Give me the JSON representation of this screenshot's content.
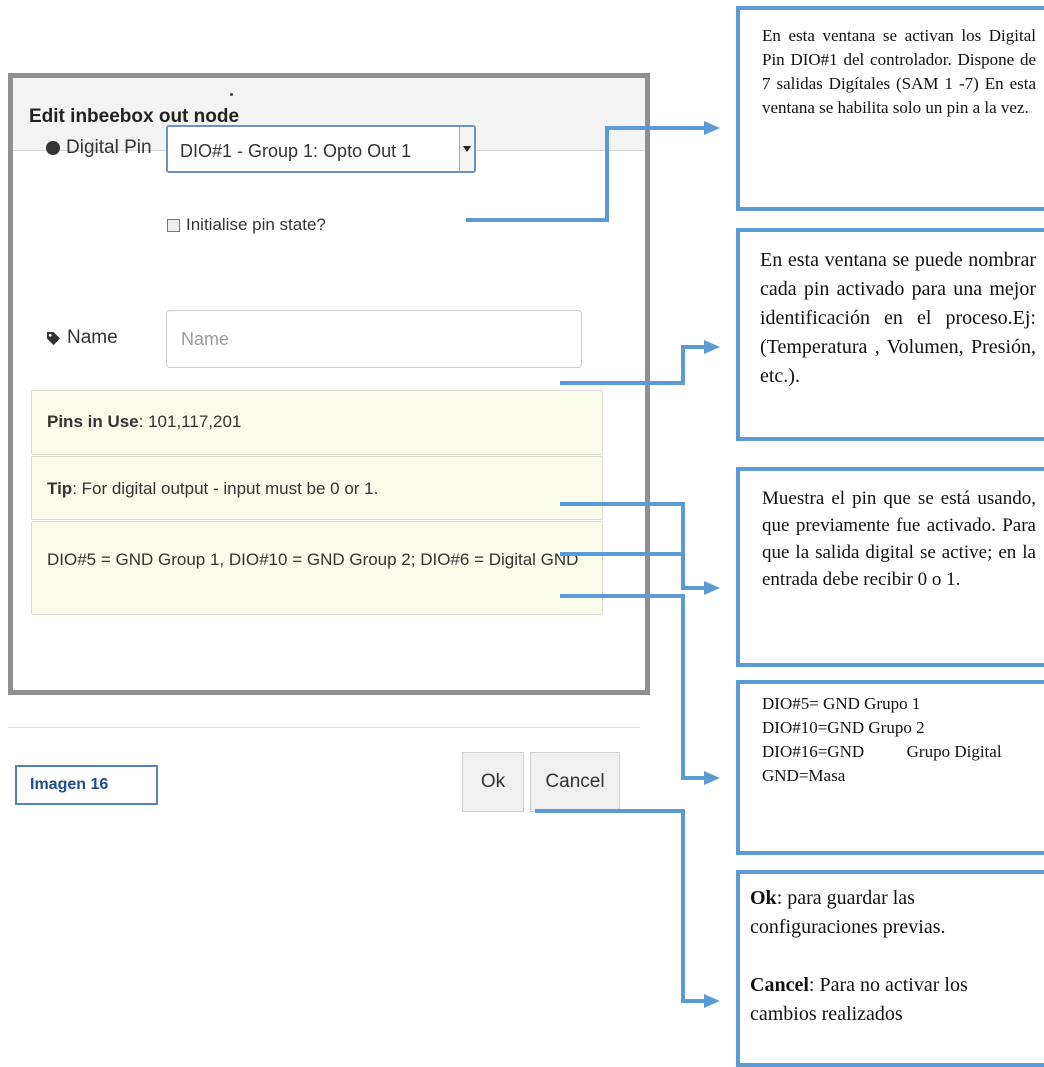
{
  "dialog": {
    "title": "Edit inbeebox out node",
    "dot_mark": ".",
    "digital_pin": {
      "label": "Digital Pin",
      "icon": "circle-icon",
      "selected": "DIO#1 - Group 1: Opto Out 1"
    },
    "initialise": {
      "label": "Initialise pin state?"
    },
    "name_field": {
      "label": "Name",
      "icon": "tag-icon",
      "placeholder": "Name",
      "value": ""
    },
    "tips": {
      "pins_in_use_label": "Pins in Use",
      "pins_in_use_value": ": 101,117,201",
      "tip_label": "Tip",
      "tip_value": ": For digital output - input must be 0 or 1.",
      "gnd_text": "DIO#5 = GND Group 1, DIO#10 = GND Group 2; DIO#6 = Digital GND"
    },
    "buttons": {
      "ok": "Ok",
      "cancel": "Cancel"
    }
  },
  "caption": "Imagen  16",
  "notes": {
    "note1": "En esta ventana se activan los Digital Pin DIO#1  del controlador. Dispone de 7 salidas Digítales (SAM 1 -7) En esta ventana se habilita solo un  pin a la vez.",
    "note2": "En esta ventana se puede nombrar cada pin activado para una mejor identificación en el proceso.Ej:(Temperatura , Volumen, Presión, etc.).",
    "note3": "Muestra el pin que se está usando, que previamente fue activado. Para que la salida digital se active; en la entrada debe recibir 0 o 1.",
    "note4": {
      "line1": "DIO#5= GND Grupo 1",
      "line2": "DIO#10=GND Grupo 2",
      "line3": "DIO#16=GND          Grupo Digital",
      "line4": "GND=Masa"
    },
    "note5": {
      "ok_label": "Ok",
      "ok_text": ": para guardar las configuraciones previas.",
      "cancel_label": "Cancel",
      "cancel_text": ": Para no activar los cambios realizados"
    }
  },
  "colors": {
    "accent_blue": "#5b9bd5",
    "caption_blue": "#4f81bd",
    "tip_bg": "#fbfbe9"
  }
}
